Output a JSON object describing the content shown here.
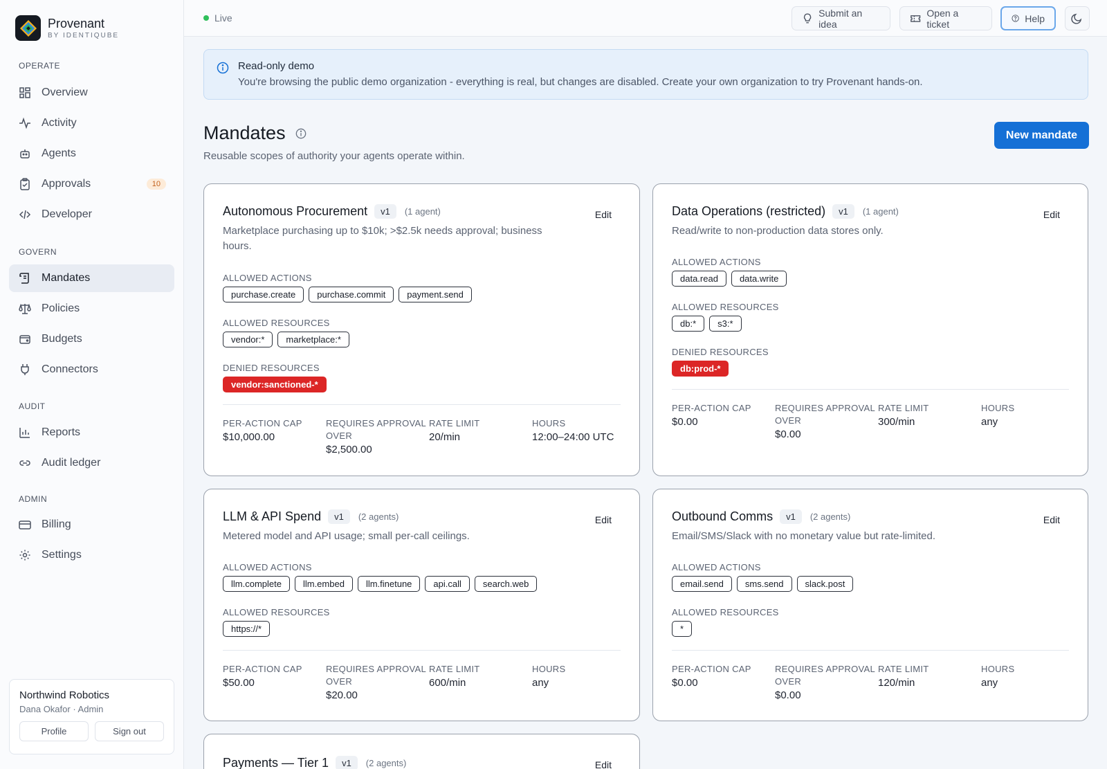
{
  "brand": {
    "name": "Provenant",
    "sub": "BY IDENTIQUBE"
  },
  "nav": {
    "sections": [
      {
        "title": "OPERATE",
        "items": [
          {
            "label": "Overview",
            "icon": "grid-icon"
          },
          {
            "label": "Activity",
            "icon": "activity-icon"
          },
          {
            "label": "Agents",
            "icon": "bot-icon"
          },
          {
            "label": "Approvals",
            "icon": "clipboard-check-icon",
            "badge": "10"
          },
          {
            "label": "Developer",
            "icon": "code-icon"
          }
        ]
      },
      {
        "title": "GOVERN",
        "items": [
          {
            "label": "Mandates",
            "icon": "scroll-icon",
            "active": true
          },
          {
            "label": "Policies",
            "icon": "scale-icon"
          },
          {
            "label": "Budgets",
            "icon": "wallet-icon"
          },
          {
            "label": "Connectors",
            "icon": "plug-icon"
          }
        ]
      },
      {
        "title": "AUDIT",
        "items": [
          {
            "label": "Reports",
            "icon": "bar-chart-icon"
          },
          {
            "label": "Audit ledger",
            "icon": "link-icon"
          }
        ]
      },
      {
        "title": "ADMIN",
        "items": [
          {
            "label": "Billing",
            "icon": "credit-card-icon"
          },
          {
            "label": "Settings",
            "icon": "gear-icon"
          }
        ]
      }
    ]
  },
  "org": {
    "name": "Northwind Robotics",
    "user": "Dana Okafor · Admin",
    "profile": "Profile",
    "signout": "Sign out"
  },
  "topbar": {
    "status": "Live",
    "idea": "Submit an idea",
    "ticket": "Open a ticket",
    "help": "Help"
  },
  "notice": {
    "title": "Read-only demo",
    "text": "You're browsing the public demo organization - everything is real, but changes are disabled. Create your own organization to try Provenant hands-on."
  },
  "page": {
    "title": "Mandates",
    "subtitle": "Reusable scopes of authority your agents operate within.",
    "new_button": "New mandate"
  },
  "labels": {
    "edit": "Edit",
    "allowed_actions": "ALLOWED ACTIONS",
    "allowed_resources": "ALLOWED RESOURCES",
    "denied_resources": "DENIED RESOURCES",
    "per_action_cap": "PER-ACTION CAP",
    "requires_approval": "REQUIRES APPROVAL OVER",
    "rate_limit": "RATE LIMIT",
    "hours": "HOURS"
  },
  "mandates": [
    {
      "title": "Autonomous Procurement",
      "version": "v1",
      "agents": "(1 agent)",
      "description": "Marketplace purchasing up to $10k; >$2.5k needs approval; business hours.",
      "allowed_actions": [
        "purchase.create",
        "purchase.commit",
        "payment.send"
      ],
      "allowed_resources": [
        "vendor:*",
        "marketplace:*"
      ],
      "denied_resources": [
        "vendor:sanctioned-*"
      ],
      "per_action_cap": "$10,000.00",
      "requires_approval": "$2,500.00",
      "rate_limit": "20/min",
      "hours": "12:00–24:00 UTC"
    },
    {
      "title": "Data Operations (restricted)",
      "version": "v1",
      "agents": "(1 agent)",
      "description": "Read/write to non-production data stores only.",
      "allowed_actions": [
        "data.read",
        "data.write"
      ],
      "allowed_resources": [
        "db:*",
        "s3:*"
      ],
      "denied_resources": [
        "db:prod-*"
      ],
      "per_action_cap": "$0.00",
      "requires_approval": "$0.00",
      "rate_limit": "300/min",
      "hours": "any"
    },
    {
      "title": "LLM & API Spend",
      "version": "v1",
      "agents": "(2 agents)",
      "description": "Metered model and API usage; small per-call ceilings.",
      "allowed_actions": [
        "llm.complete",
        "llm.embed",
        "llm.finetune",
        "api.call",
        "search.web"
      ],
      "allowed_resources": [
        "https://*"
      ],
      "denied_resources": [],
      "per_action_cap": "$50.00",
      "requires_approval": "$20.00",
      "rate_limit": "600/min",
      "hours": "any"
    },
    {
      "title": "Outbound Comms",
      "version": "v1",
      "agents": "(2 agents)",
      "description": "Email/SMS/Slack with no monetary value but rate-limited.",
      "allowed_actions": [
        "email.send",
        "sms.send",
        "slack.post"
      ],
      "allowed_resources": [
        "*"
      ],
      "denied_resources": [],
      "per_action_cap": "$0.00",
      "requires_approval": "$0.00",
      "rate_limit": "120/min",
      "hours": "any"
    },
    {
      "title": "Payments — Tier 1",
      "version": "v1",
      "agents": "(2 agents)"
    }
  ]
}
